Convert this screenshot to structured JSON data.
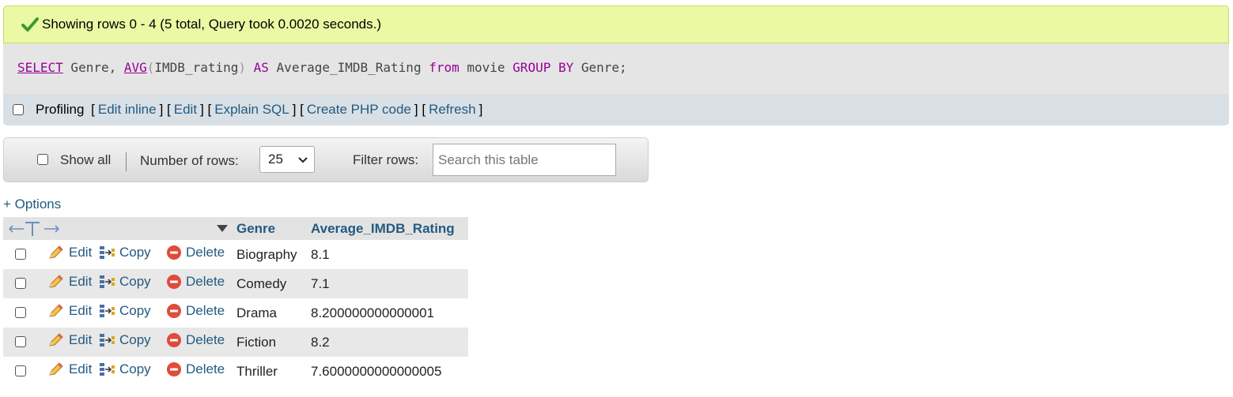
{
  "message": {
    "text": "Showing rows 0 - 4 (5 total, Query took 0.0020 seconds.)"
  },
  "sql": {
    "select": "SELECT",
    "col1": " Genre, ",
    "avg": "AVG",
    "open": "(",
    "arg": "IMDB_rating",
    "close": ")",
    "as": " AS ",
    "alias": "Average_IMDB_Rating ",
    "from": "from",
    "table": " movie ",
    "group": "GROUP BY",
    "col2": " Genre;"
  },
  "profiling": {
    "label": "Profiling",
    "links": [
      "Edit inline",
      "Edit",
      "Explain SQL",
      "Create PHP code",
      "Refresh"
    ]
  },
  "navigation": {
    "show_all": "Show all",
    "rows_label": "Number of rows:",
    "rows_value": "25",
    "filter_label": "Filter rows:",
    "search_placeholder": "Search this table"
  },
  "options_link": "+ Options",
  "table": {
    "columns": [
      "Genre",
      "Average_IMDB_Rating"
    ],
    "actions": {
      "edit": "Edit",
      "copy": "Copy",
      "delete": "Delete"
    },
    "rows": [
      {
        "genre": "Biography",
        "rating": "8.1"
      },
      {
        "genre": "Comedy",
        "rating": "7.1"
      },
      {
        "genre": "Drama",
        "rating": "8.200000000000001"
      },
      {
        "genre": "Fiction",
        "rating": "8.2"
      },
      {
        "genre": "Thriller",
        "rating": "7.6000000000000005"
      }
    ]
  },
  "colors": {
    "success_bg": "#ebf8a4",
    "link": "#235a81",
    "sql_keyword": "#990099"
  }
}
